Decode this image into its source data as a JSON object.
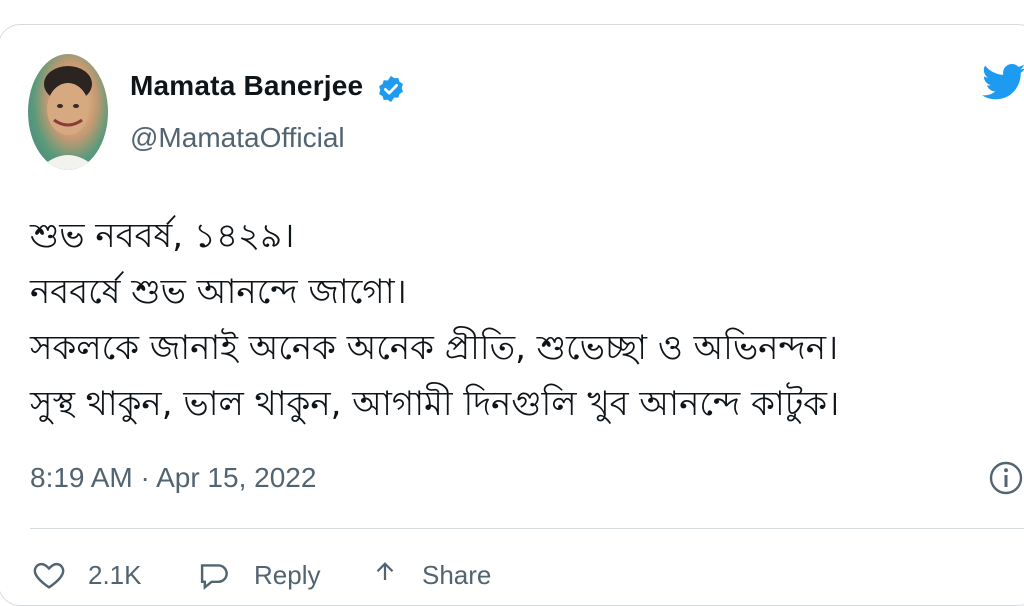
{
  "tweet": {
    "author_name": "Mamata Banerjee",
    "handle": "@MamataOfficial",
    "lines": [
      "শুভ নববর্ষ, ১৪২৯।",
      "নববর্ষে শুভ আনন্দে জাগো।",
      "সকলকে জানাই অনেক অনেক প্রীতি, শুভেচ্ছা ও অভিনন্দন।",
      "সুস্থ থাকুন, ভাল থাকুন, আগামী দিনগুলি খুব আনন্দে কাটুক।"
    ],
    "timestamp": "8:19 AM · Apr 15, 2022"
  },
  "actions": {
    "like_count": "2.1K",
    "reply_label": "Reply",
    "share_label": "Share"
  },
  "icons": {
    "verified": "verified-badge-icon",
    "logo": "twitter-bird-icon",
    "info": "info-icon",
    "like": "heart-icon",
    "reply": "reply-bubble-icon",
    "share": "share-arrow-icon"
  },
  "colors": {
    "brand": "#1d9bf0",
    "text": "#0f1419",
    "muted": "#536471",
    "border": "#d6dbe0"
  }
}
